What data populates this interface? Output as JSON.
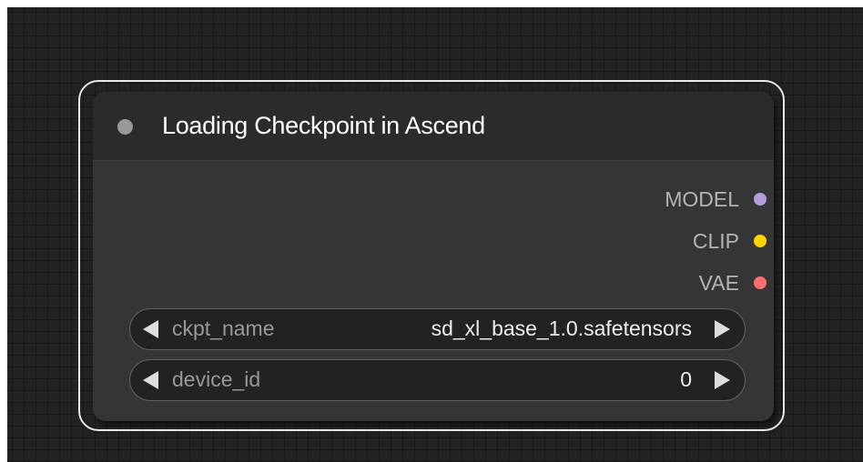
{
  "node": {
    "title": "Loading Checkpoint in Ascend",
    "outputs": [
      {
        "label": "MODEL",
        "color": "#b39ddb"
      },
      {
        "label": "CLIP",
        "color": "#ffd500"
      },
      {
        "label": "VAE",
        "color": "#ff6e6e"
      }
    ],
    "widgets": [
      {
        "name": "ckpt_name",
        "value": "sd_xl_base_1.0.safetensors"
      },
      {
        "name": "device_id",
        "value": "0"
      }
    ]
  },
  "colors": {
    "canvas": "#222222",
    "node_body": "#353535",
    "node_header": "#2b2b2b",
    "selection_outline": "#e8e8e8"
  }
}
